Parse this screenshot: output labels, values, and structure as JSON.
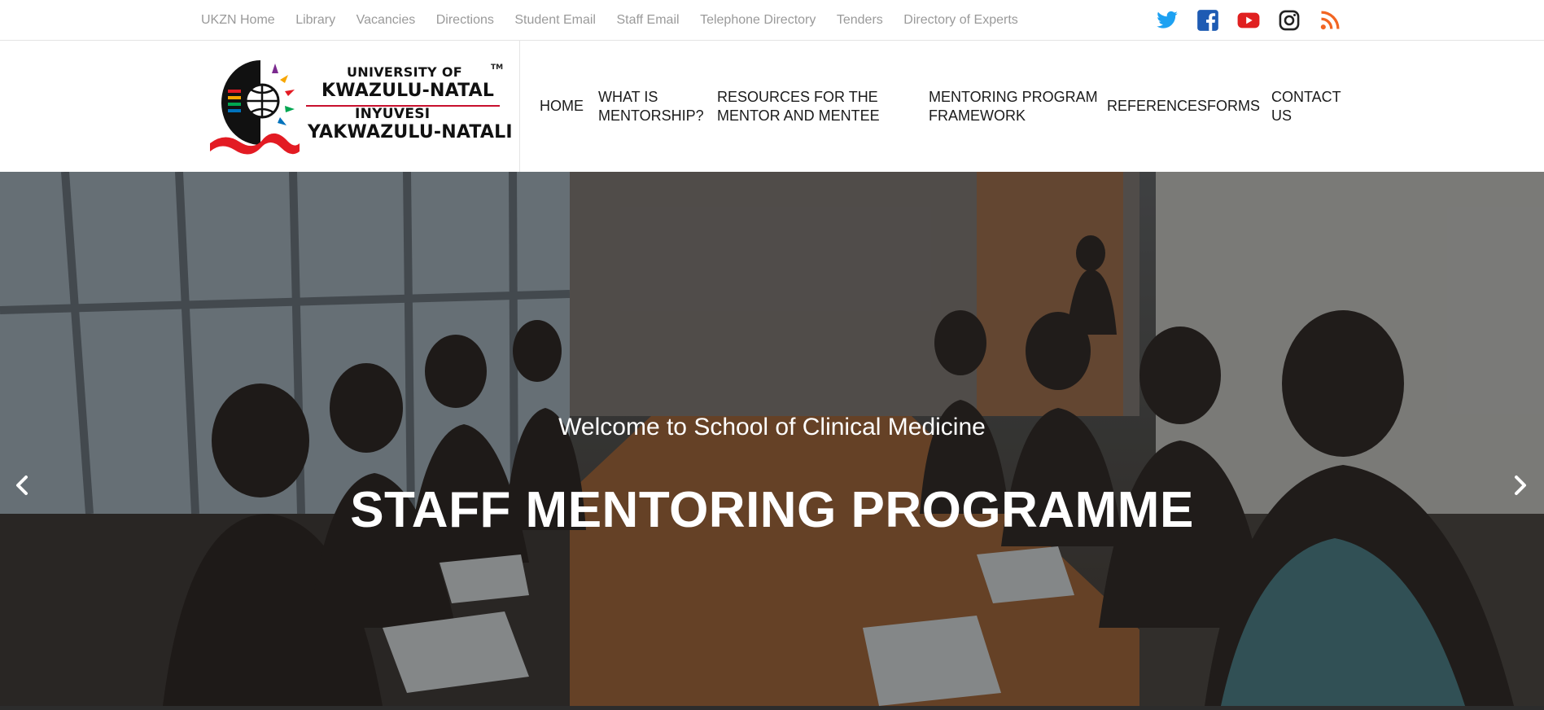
{
  "topbar": {
    "links": [
      "UKZN Home",
      "Library",
      "Vacancies",
      "Directions",
      "Student Email",
      "Staff Email",
      "Telephone Directory",
      "Tenders",
      "Directory of Experts"
    ],
    "social": [
      {
        "icon": "twitter-icon",
        "color": "#1da1f2"
      },
      {
        "icon": "facebook-icon",
        "color": "#1e5bb3"
      },
      {
        "icon": "youtube-icon",
        "color": "#e02020"
      },
      {
        "icon": "instagram-icon",
        "color": "#222222"
      },
      {
        "icon": "rss-icon",
        "color": "#f26522"
      }
    ]
  },
  "logo": {
    "line1": "UNIVERSITY OF",
    "line2": "KWAZULU-NATAL",
    "line3": "INYUVESI",
    "line4": "YAKWAZULU-NATALI",
    "tm": "TM"
  },
  "nav": {
    "home": "HOME",
    "what": "WHAT IS MENTORSHIP?",
    "resources": "RESOURCES FOR THE MENTOR AND MENTEE",
    "framework": "MENTORING PROGRAM FRAMEWORK",
    "references": "REFERENCES",
    "forms": "FORMS",
    "contact": "CONTACT US"
  },
  "hero": {
    "subtitle": "Welcome to School of Clinical Medicine",
    "title": "STAFF MENTORING PROGRAMME",
    "prev_icon": "chevron-left-icon",
    "next_icon": "chevron-right-icon"
  }
}
